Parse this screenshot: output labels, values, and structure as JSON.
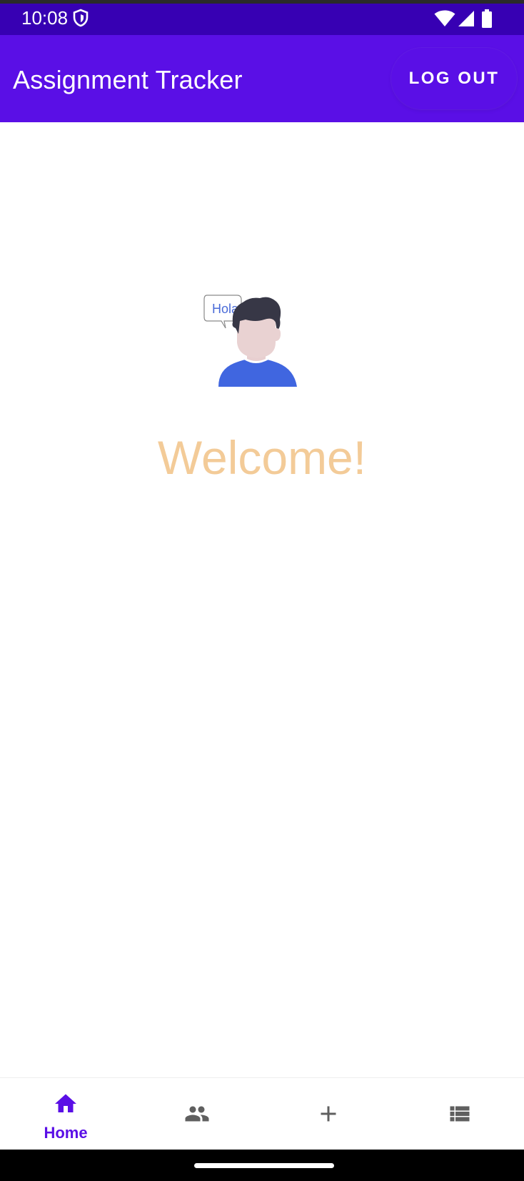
{
  "status_bar": {
    "time": "10:08",
    "icons": [
      "shield-icon",
      "wifi-icon",
      "signal-icon",
      "battery-icon"
    ]
  },
  "app_bar": {
    "title": "Assignment Tracker",
    "logout_label": "LOG OUT"
  },
  "main": {
    "illustration": {
      "name": "avatar-illustration",
      "speech_bubble_text": "Hola"
    },
    "welcome_text": "Welcome!"
  },
  "bottom_nav": {
    "items": [
      {
        "label": "Home",
        "icon": "home-icon",
        "selected": true
      },
      {
        "label": "",
        "icon": "people-icon",
        "selected": false
      },
      {
        "label": "",
        "icon": "add-icon",
        "selected": false
      },
      {
        "label": "",
        "icon": "list-icon",
        "selected": false
      }
    ]
  },
  "colors": {
    "status_bar": "#3700b3",
    "app_bar": "#5a0fe6",
    "welcome_text": "#f3cb98",
    "nav_selected": "#5a0fe6",
    "nav_unselected": "#5f5f5f"
  }
}
